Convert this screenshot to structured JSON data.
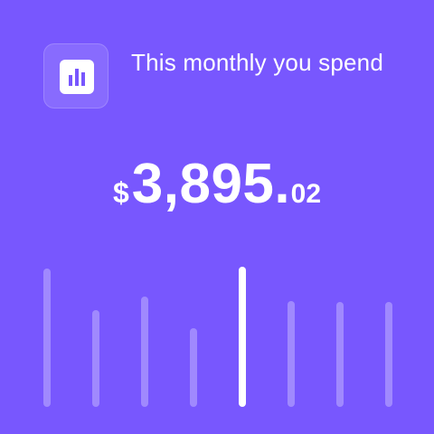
{
  "header": {
    "icon": "bar-chart-icon",
    "title": "This monthly you spend"
  },
  "amount": {
    "currency": "$",
    "whole": "3,895",
    "separator": ".",
    "cents": "02"
  },
  "colors": {
    "background": "#7857fe",
    "foreground": "#ffffff",
    "bar_inactive": "rgba(255,255,255,0.3)"
  },
  "chart_data": {
    "type": "bar",
    "values": [
      0.9,
      0.63,
      0.72,
      0.51,
      0.91,
      0.69,
      0.68,
      0.68
    ],
    "active_index": 4
  }
}
